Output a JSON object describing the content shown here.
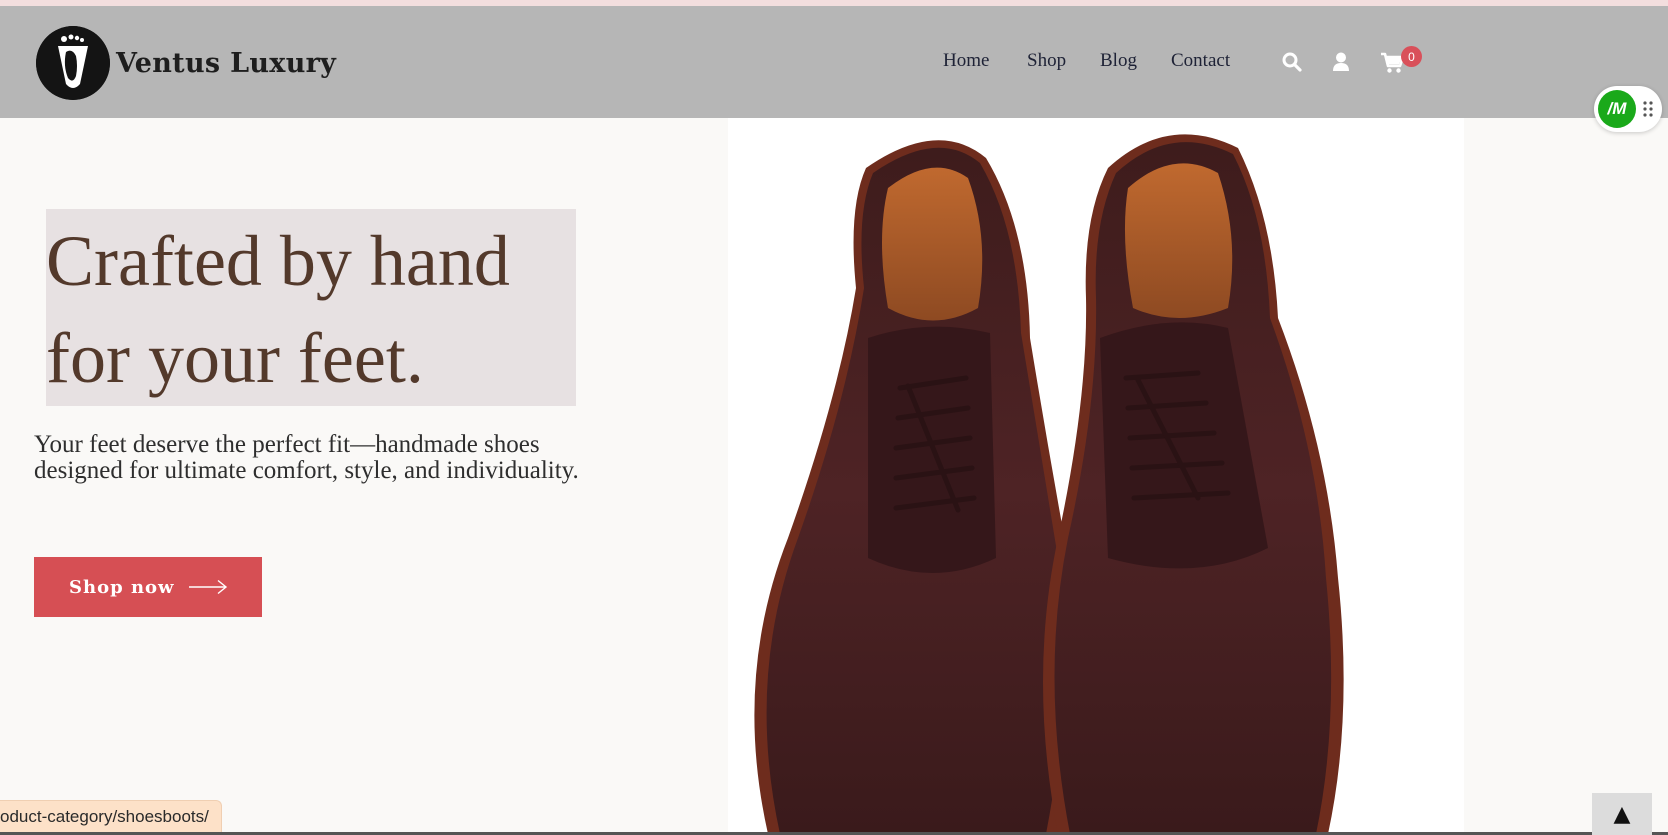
{
  "site": {
    "name": "Ventus Luxury"
  },
  "nav": {
    "items": [
      "Home",
      "Shop",
      "Blog",
      "Contact"
    ]
  },
  "header_icons": {
    "search": "search-icon",
    "account": "user-icon",
    "cart": "cart-icon",
    "cart_count": "0"
  },
  "widget": {
    "label": "/M"
  },
  "hero": {
    "headline_line1": "Crafted by hand",
    "headline_line2": "for your feet.",
    "subtext_line1": "Your feet deserve the perfect fit—handmade shoes",
    "subtext_line2": "designed for ultimate comfort, style, and individuality.",
    "cta_label": "Shop now",
    "image": "brown-leather-derby-shoes"
  },
  "status_bar": {
    "url": "oduct-category/shoesboots/"
  },
  "scroll_top": {
    "glyph": "▲"
  },
  "colors": {
    "header_bg": "#b6b6b6",
    "accent": "#d64f54",
    "headline": "#53392b",
    "badge": "#d9505a",
    "widget": "#1aa91a"
  }
}
